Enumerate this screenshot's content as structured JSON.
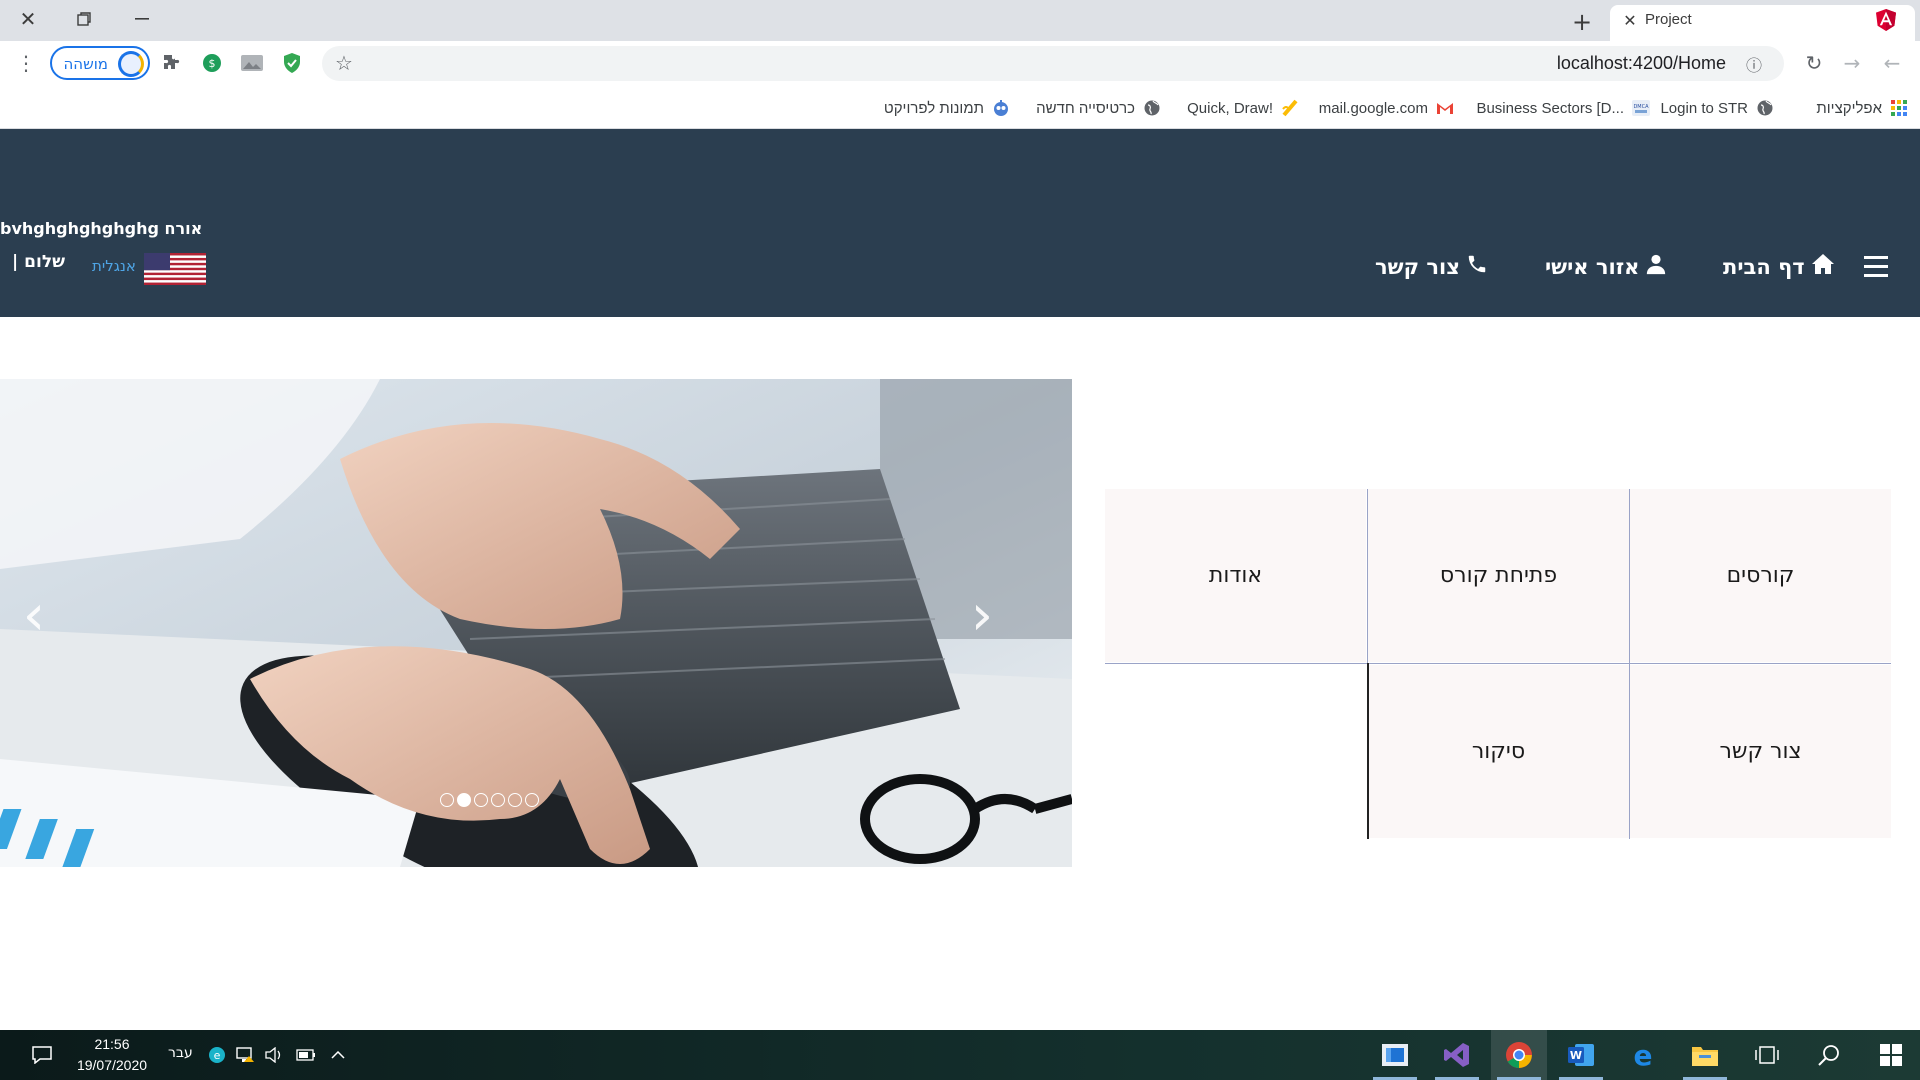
{
  "browser": {
    "tab": {
      "title": "Project"
    },
    "url": "localhost:4200/Home",
    "profile": {
      "label": "מושהה"
    },
    "bookmarks": [
      {
        "label": "אפליקציות",
        "icon": "apps-grid-icon"
      },
      {
        "label": "Login to STR",
        "icon": "globe-icon"
      },
      {
        "label": "Business Sectors [D...",
        "icon": "dmca-icon"
      },
      {
        "label": "mail.google.com",
        "icon": "gmail-icon"
      },
      {
        "label": "Quick, Draw!",
        "icon": "quickdraw-icon"
      },
      {
        "label": "כרטיסייה חדשה",
        "icon": "globe-icon"
      },
      {
        "label": "תמונות לפרויקט",
        "icon": "bot-icon"
      }
    ]
  },
  "site": {
    "user_greeting": "bvhghghghghghg אורח",
    "hello": "| שלום",
    "language_link": "אנגלית",
    "nav": {
      "home": "דף הבית",
      "personal": "אזור אישי",
      "contact": "צור קשר"
    },
    "colors": {
      "header_bg": "#2b3e50",
      "tile_bg": "#fbf7f7",
      "link": "#4ea5e6"
    }
  },
  "carousel": {
    "slide_count": 6,
    "active_index": 1,
    "prev_label": "‹",
    "next_label": "›"
  },
  "tiles": {
    "courses": "קורסים",
    "open_course": "פתיחת קורס",
    "about": "אודות",
    "contact": "צור קשר",
    "summary": "סיקור"
  },
  "taskbar": {
    "time": "21:56",
    "date": "19/07/2020",
    "input_language": "עבר"
  }
}
